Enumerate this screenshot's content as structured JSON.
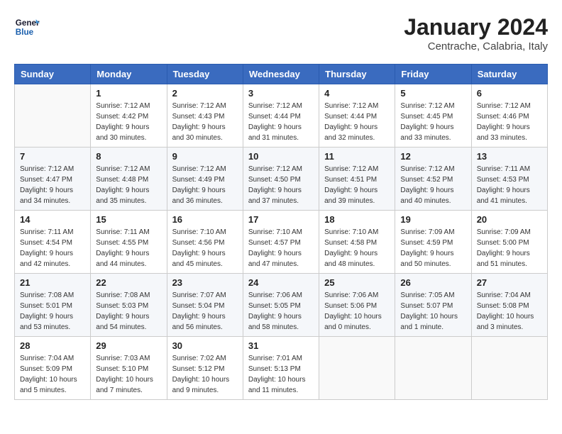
{
  "header": {
    "logo_line1": "General",
    "logo_line2": "Blue",
    "month": "January 2024",
    "location": "Centrache, Calabria, Italy"
  },
  "weekdays": [
    "Sunday",
    "Monday",
    "Tuesday",
    "Wednesday",
    "Thursday",
    "Friday",
    "Saturday"
  ],
  "weeks": [
    [
      {
        "day": "",
        "sunrise": "",
        "sunset": "",
        "daylight": ""
      },
      {
        "day": "1",
        "sunrise": "7:12 AM",
        "sunset": "4:42 PM",
        "daylight": "9 hours and 30 minutes."
      },
      {
        "day": "2",
        "sunrise": "7:12 AM",
        "sunset": "4:43 PM",
        "daylight": "9 hours and 30 minutes."
      },
      {
        "day": "3",
        "sunrise": "7:12 AM",
        "sunset": "4:44 PM",
        "daylight": "9 hours and 31 minutes."
      },
      {
        "day": "4",
        "sunrise": "7:12 AM",
        "sunset": "4:44 PM",
        "daylight": "9 hours and 32 minutes."
      },
      {
        "day": "5",
        "sunrise": "7:12 AM",
        "sunset": "4:45 PM",
        "daylight": "9 hours and 33 minutes."
      },
      {
        "day": "6",
        "sunrise": "7:12 AM",
        "sunset": "4:46 PM",
        "daylight": "9 hours and 33 minutes."
      }
    ],
    [
      {
        "day": "7",
        "sunrise": "7:12 AM",
        "sunset": "4:47 PM",
        "daylight": "9 hours and 34 minutes."
      },
      {
        "day": "8",
        "sunrise": "7:12 AM",
        "sunset": "4:48 PM",
        "daylight": "9 hours and 35 minutes."
      },
      {
        "day": "9",
        "sunrise": "7:12 AM",
        "sunset": "4:49 PM",
        "daylight": "9 hours and 36 minutes."
      },
      {
        "day": "10",
        "sunrise": "7:12 AM",
        "sunset": "4:50 PM",
        "daylight": "9 hours and 37 minutes."
      },
      {
        "day": "11",
        "sunrise": "7:12 AM",
        "sunset": "4:51 PM",
        "daylight": "9 hours and 39 minutes."
      },
      {
        "day": "12",
        "sunrise": "7:12 AM",
        "sunset": "4:52 PM",
        "daylight": "9 hours and 40 minutes."
      },
      {
        "day": "13",
        "sunrise": "7:11 AM",
        "sunset": "4:53 PM",
        "daylight": "9 hours and 41 minutes."
      }
    ],
    [
      {
        "day": "14",
        "sunrise": "7:11 AM",
        "sunset": "4:54 PM",
        "daylight": "9 hours and 42 minutes."
      },
      {
        "day": "15",
        "sunrise": "7:11 AM",
        "sunset": "4:55 PM",
        "daylight": "9 hours and 44 minutes."
      },
      {
        "day": "16",
        "sunrise": "7:10 AM",
        "sunset": "4:56 PM",
        "daylight": "9 hours and 45 minutes."
      },
      {
        "day": "17",
        "sunrise": "7:10 AM",
        "sunset": "4:57 PM",
        "daylight": "9 hours and 47 minutes."
      },
      {
        "day": "18",
        "sunrise": "7:10 AM",
        "sunset": "4:58 PM",
        "daylight": "9 hours and 48 minutes."
      },
      {
        "day": "19",
        "sunrise": "7:09 AM",
        "sunset": "4:59 PM",
        "daylight": "9 hours and 50 minutes."
      },
      {
        "day": "20",
        "sunrise": "7:09 AM",
        "sunset": "5:00 PM",
        "daylight": "9 hours and 51 minutes."
      }
    ],
    [
      {
        "day": "21",
        "sunrise": "7:08 AM",
        "sunset": "5:01 PM",
        "daylight": "9 hours and 53 minutes."
      },
      {
        "day": "22",
        "sunrise": "7:08 AM",
        "sunset": "5:03 PM",
        "daylight": "9 hours and 54 minutes."
      },
      {
        "day": "23",
        "sunrise": "7:07 AM",
        "sunset": "5:04 PM",
        "daylight": "9 hours and 56 minutes."
      },
      {
        "day": "24",
        "sunrise": "7:06 AM",
        "sunset": "5:05 PM",
        "daylight": "9 hours and 58 minutes."
      },
      {
        "day": "25",
        "sunrise": "7:06 AM",
        "sunset": "5:06 PM",
        "daylight": "10 hours and 0 minutes."
      },
      {
        "day": "26",
        "sunrise": "7:05 AM",
        "sunset": "5:07 PM",
        "daylight": "10 hours and 1 minute."
      },
      {
        "day": "27",
        "sunrise": "7:04 AM",
        "sunset": "5:08 PM",
        "daylight": "10 hours and 3 minutes."
      }
    ],
    [
      {
        "day": "28",
        "sunrise": "7:04 AM",
        "sunset": "5:09 PM",
        "daylight": "10 hours and 5 minutes."
      },
      {
        "day": "29",
        "sunrise": "7:03 AM",
        "sunset": "5:10 PM",
        "daylight": "10 hours and 7 minutes."
      },
      {
        "day": "30",
        "sunrise": "7:02 AM",
        "sunset": "5:12 PM",
        "daylight": "10 hours and 9 minutes."
      },
      {
        "day": "31",
        "sunrise": "7:01 AM",
        "sunset": "5:13 PM",
        "daylight": "10 hours and 11 minutes."
      },
      {
        "day": "",
        "sunrise": "",
        "sunset": "",
        "daylight": ""
      },
      {
        "day": "",
        "sunrise": "",
        "sunset": "",
        "daylight": ""
      },
      {
        "day": "",
        "sunrise": "",
        "sunset": "",
        "daylight": ""
      }
    ]
  ]
}
